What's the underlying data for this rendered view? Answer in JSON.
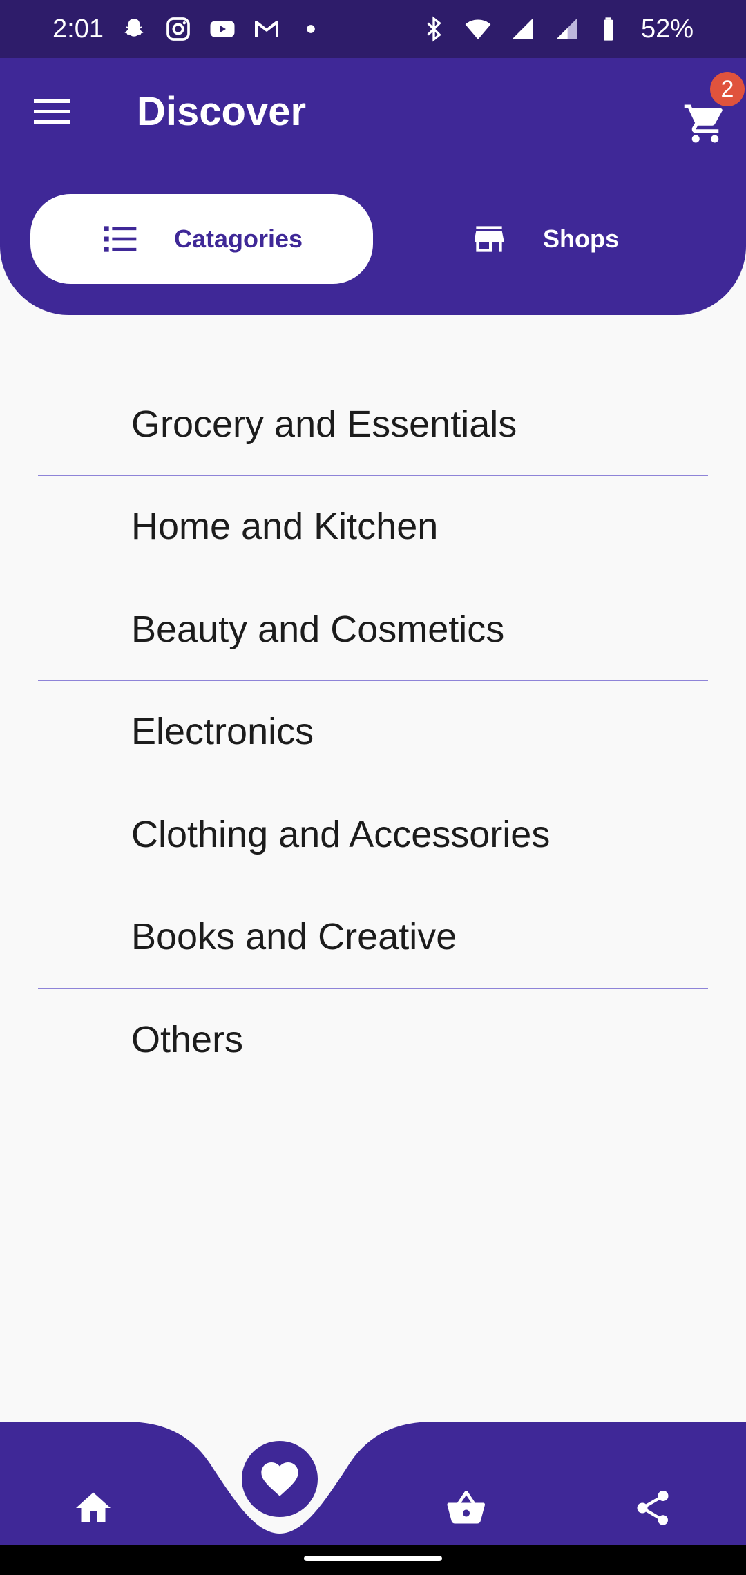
{
  "status_bar": {
    "time": "2:01",
    "battery": "52%",
    "left_icons": [
      "snapchat-icon",
      "instagram-icon",
      "youtube-icon",
      "gmail-icon",
      "dot-icon"
    ],
    "right_icons": [
      "bluetooth-icon",
      "wifi-icon",
      "signal-icon",
      "signal-icon",
      "battery-icon"
    ]
  },
  "header": {
    "title": "Discover",
    "cart_count": "2",
    "tabs": [
      {
        "label": "Catagories",
        "icon": "list-icon",
        "active": true
      },
      {
        "label": "Shops",
        "icon": "store-icon",
        "active": false
      }
    ]
  },
  "categories": [
    "Grocery and Essentials",
    "Home and Kitchen",
    "Beauty and Cosmetics",
    "Electronics",
    "Clothing and Accessories",
    "Books and Creative",
    "Others"
  ],
  "bottom_nav": {
    "items": [
      "home-icon",
      "heart-icon",
      "basket-icon",
      "share-icon"
    ]
  },
  "colors": {
    "primary": "#3f2897",
    "status_bar": "#2e1c6a",
    "badge": "#e0533d",
    "divider": "#8e84d8",
    "background": "#f9f9f9"
  }
}
